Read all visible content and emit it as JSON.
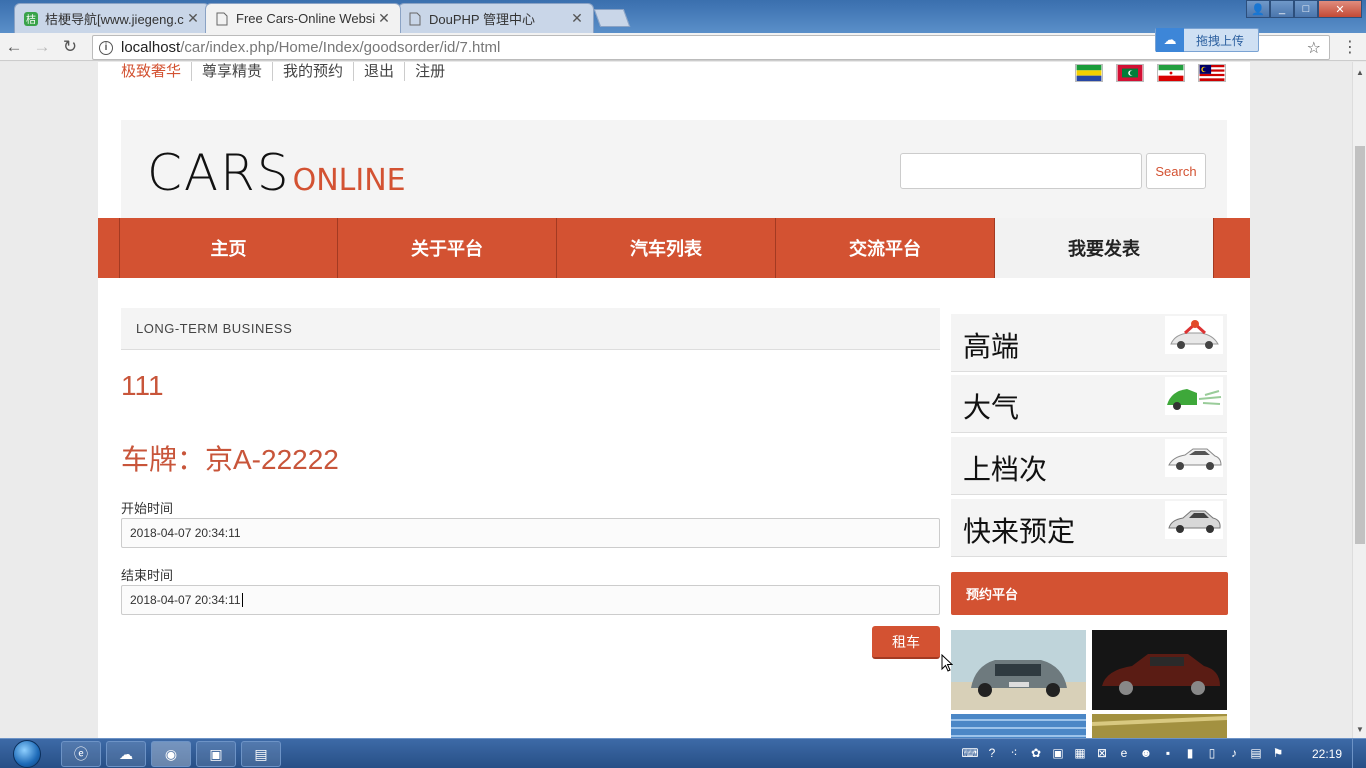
{
  "browser": {
    "tabs": [
      {
        "title": "桔梗导航[www.jiegeng.c",
        "active": false,
        "icon": "jiegeng-favicon"
      },
      {
        "title": "Free Cars-Online Websi",
        "active": true,
        "icon": "page-icon"
      },
      {
        "title": "DouPHP 管理中心",
        "active": false,
        "icon": "page-icon"
      }
    ],
    "address": {
      "host": "localhost",
      "path": "/car/index.php/Home/Index/goodsorder/id/7.html"
    },
    "upload_label": "拖拽上传"
  },
  "site": {
    "topnav": [
      "极致奢华",
      "尊享精贵",
      "我的预约",
      "退出",
      "注册"
    ],
    "flags": [
      {
        "name": "gabon-flag",
        "colors": [
          "#1a9c3a",
          "#f5d000",
          "#2747a4"
        ]
      },
      {
        "name": "maldives-flag",
        "colors": [
          "#d21034",
          "#007e3a",
          "#ffffff"
        ]
      },
      {
        "name": "iran-flag",
        "colors": [
          "#239f40",
          "#ffffff",
          "#da0000"
        ]
      },
      {
        "name": "malaysia-flag",
        "colors": [
          "#cc0001",
          "#ffffff",
          "#010066"
        ]
      }
    ],
    "logo": {
      "main": "CARS",
      "sub": "ONLINE"
    },
    "search": {
      "button": "Search",
      "placeholder": ""
    },
    "mainnav": [
      {
        "label": "主页",
        "active": false
      },
      {
        "label": "关于平台",
        "active": false
      },
      {
        "label": "汽车列表",
        "active": false
      },
      {
        "label": "交流平台",
        "active": false
      },
      {
        "label": "我要发表",
        "active": true
      }
    ]
  },
  "order": {
    "section_title": "LONG-TERM BUSINESS",
    "car_name": "111",
    "plate_text": "车牌：京A-22222",
    "start_label": "开始时间",
    "start_value": "2018-04-07 20:34:11",
    "end_label": "结束时间",
    "end_value": "2018-04-07 20:34:11",
    "submit": "租车"
  },
  "sidebar": {
    "cards": [
      {
        "label": "高端",
        "icon": "red-car-gift-thumb"
      },
      {
        "label": "大气",
        "icon": "green-car-thumb"
      },
      {
        "label": "上档次",
        "icon": "white-sedan-thumb"
      },
      {
        "label": "快来预定",
        "icon": "silver-sedan-thumb"
      }
    ],
    "booking_title": "预约平台"
  },
  "taskbar": {
    "clock": "22:19"
  },
  "colors": {
    "accent": "#d35232",
    "title_text": "#c8553a"
  }
}
